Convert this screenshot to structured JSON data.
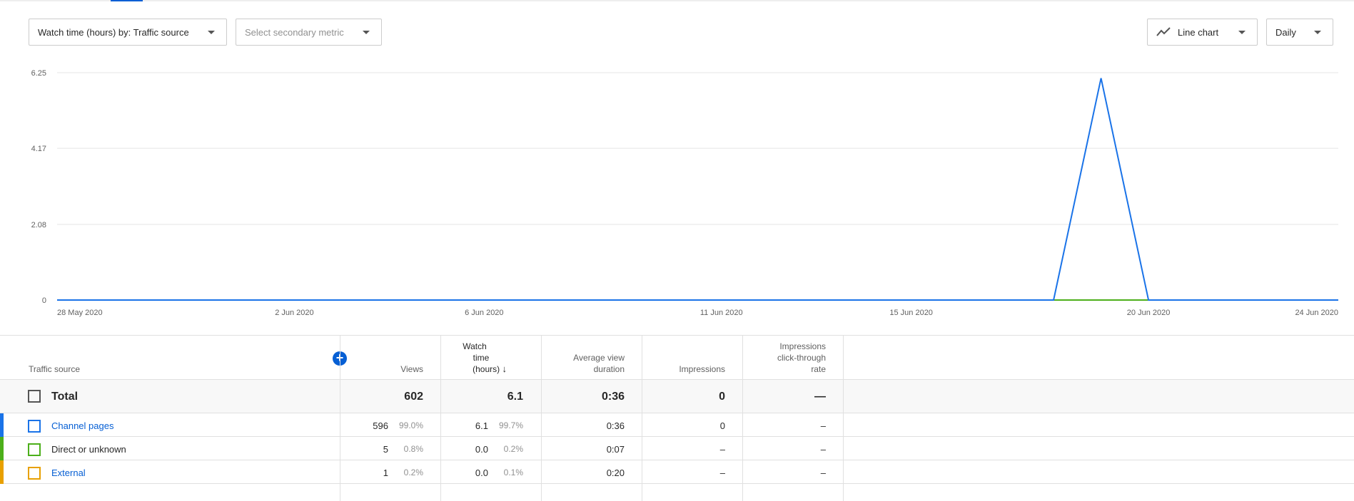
{
  "controls": {
    "primary_metric": "Watch time (hours) by: Traffic source",
    "secondary_metric_placeholder": "Select secondary metric",
    "chart_type": "Line chart",
    "granularity": "Daily"
  },
  "chart_data": {
    "type": "line",
    "x_tick_labels": [
      "28 May 2020",
      "2 Jun 2020",
      "6 Jun 2020",
      "11 Jun 2020",
      "15 Jun 2020",
      "20 Jun 2020",
      "24 Jun 2020"
    ],
    "y_tick_labels": [
      "6.25",
      "4.17",
      "2.08",
      "0"
    ],
    "ylim": [
      0,
      6.25
    ],
    "x_dates": [
      "2020-05-28",
      "2020-05-29",
      "2020-05-30",
      "2020-05-31",
      "2020-06-01",
      "2020-06-02",
      "2020-06-03",
      "2020-06-04",
      "2020-06-05",
      "2020-06-06",
      "2020-06-07",
      "2020-06-08",
      "2020-06-09",
      "2020-06-10",
      "2020-06-11",
      "2020-06-12",
      "2020-06-13",
      "2020-06-14",
      "2020-06-15",
      "2020-06-16",
      "2020-06-17",
      "2020-06-18",
      "2020-06-19",
      "2020-06-20",
      "2020-06-21",
      "2020-06-22",
      "2020-06-23",
      "2020-06-24"
    ],
    "series": [
      {
        "name": "Channel pages",
        "color": "#1a73e8",
        "values": [
          0,
          0,
          0,
          0,
          0,
          0,
          0,
          0,
          0,
          0,
          0,
          0,
          0,
          0,
          0,
          0,
          0,
          0,
          0,
          0,
          0,
          0,
          6.1,
          0,
          0,
          0,
          0,
          0
        ]
      },
      {
        "name": "Direct or unknown",
        "color": "#4caf1a",
        "values": [
          0,
          0,
          0,
          0,
          0,
          0,
          0,
          0,
          0,
          0,
          0,
          0,
          0,
          0,
          0,
          0,
          0,
          0,
          0,
          0,
          0,
          0,
          0,
          0,
          0,
          0,
          0,
          0
        ]
      },
      {
        "name": "External",
        "color": "#e8a000",
        "values": [
          0,
          0,
          0,
          0,
          0,
          0,
          0,
          0,
          0,
          0,
          0,
          0,
          0,
          0,
          0,
          0,
          0,
          0,
          0,
          0,
          0,
          0,
          0,
          0,
          0,
          0,
          0,
          0
        ]
      }
    ]
  },
  "table": {
    "headers": {
      "source": "Traffic source",
      "views": "Views",
      "watch_time_1": "Watch",
      "watch_time_2": "time",
      "watch_time_3": "(hours)",
      "avg_1": "Average view",
      "avg_2": "duration",
      "impressions": "Impressions",
      "ctr_1": "Impressions",
      "ctr_2": "click-through",
      "ctr_3": "rate"
    },
    "add_column": "+",
    "sort_arrow": "↓",
    "total": {
      "label": "Total",
      "views": "602",
      "watch_time": "6.1",
      "avg_duration": "0:36",
      "impressions": "0",
      "ctr": "—"
    },
    "rows": [
      {
        "label": "Channel pages",
        "color": "#1a73e8",
        "views": "596",
        "views_pct": "99.0%",
        "watch": "6.1",
        "watch_pct": "99.7%",
        "avg": "0:36",
        "impressions": "0",
        "ctr": "–"
      },
      {
        "label": "Direct or unknown",
        "color": "#4caf1a",
        "views": "5",
        "views_pct": "0.8%",
        "watch": "0.0",
        "watch_pct": "0.2%",
        "avg": "0:07",
        "impressions": "–",
        "ctr": "–"
      },
      {
        "label": "External",
        "color": "#e8a000",
        "views": "1",
        "views_pct": "0.2%",
        "watch": "0.0",
        "watch_pct": "0.1%",
        "avg": "0:20",
        "impressions": "–",
        "ctr": "–"
      }
    ]
  }
}
